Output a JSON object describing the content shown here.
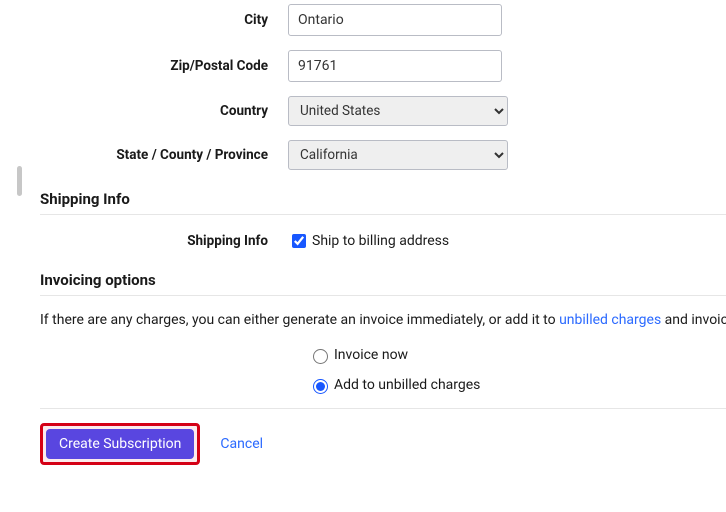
{
  "address": {
    "city": {
      "label": "City",
      "value": "Ontario"
    },
    "zip": {
      "label": "Zip/Postal Code",
      "value": "91761"
    },
    "country": {
      "label": "Country",
      "value": "United States"
    },
    "state": {
      "label": "State / County / Province",
      "value": "California"
    }
  },
  "shipping": {
    "heading": "Shipping Info",
    "row_label": "Shipping Info",
    "checkbox_label": "Ship to billing address",
    "checked": true
  },
  "invoicing": {
    "heading": "Invoicing options",
    "desc_part1": "If there are any charges, you can either generate an invoice immediately, or add it to ",
    "desc_link": "unbilled charges",
    "desc_part2": " and invoice",
    "option_now": "Invoice now",
    "option_unbilled": "Add to unbilled charges",
    "selected": "unbilled"
  },
  "actions": {
    "submit": "Create Subscription",
    "cancel": "Cancel"
  }
}
